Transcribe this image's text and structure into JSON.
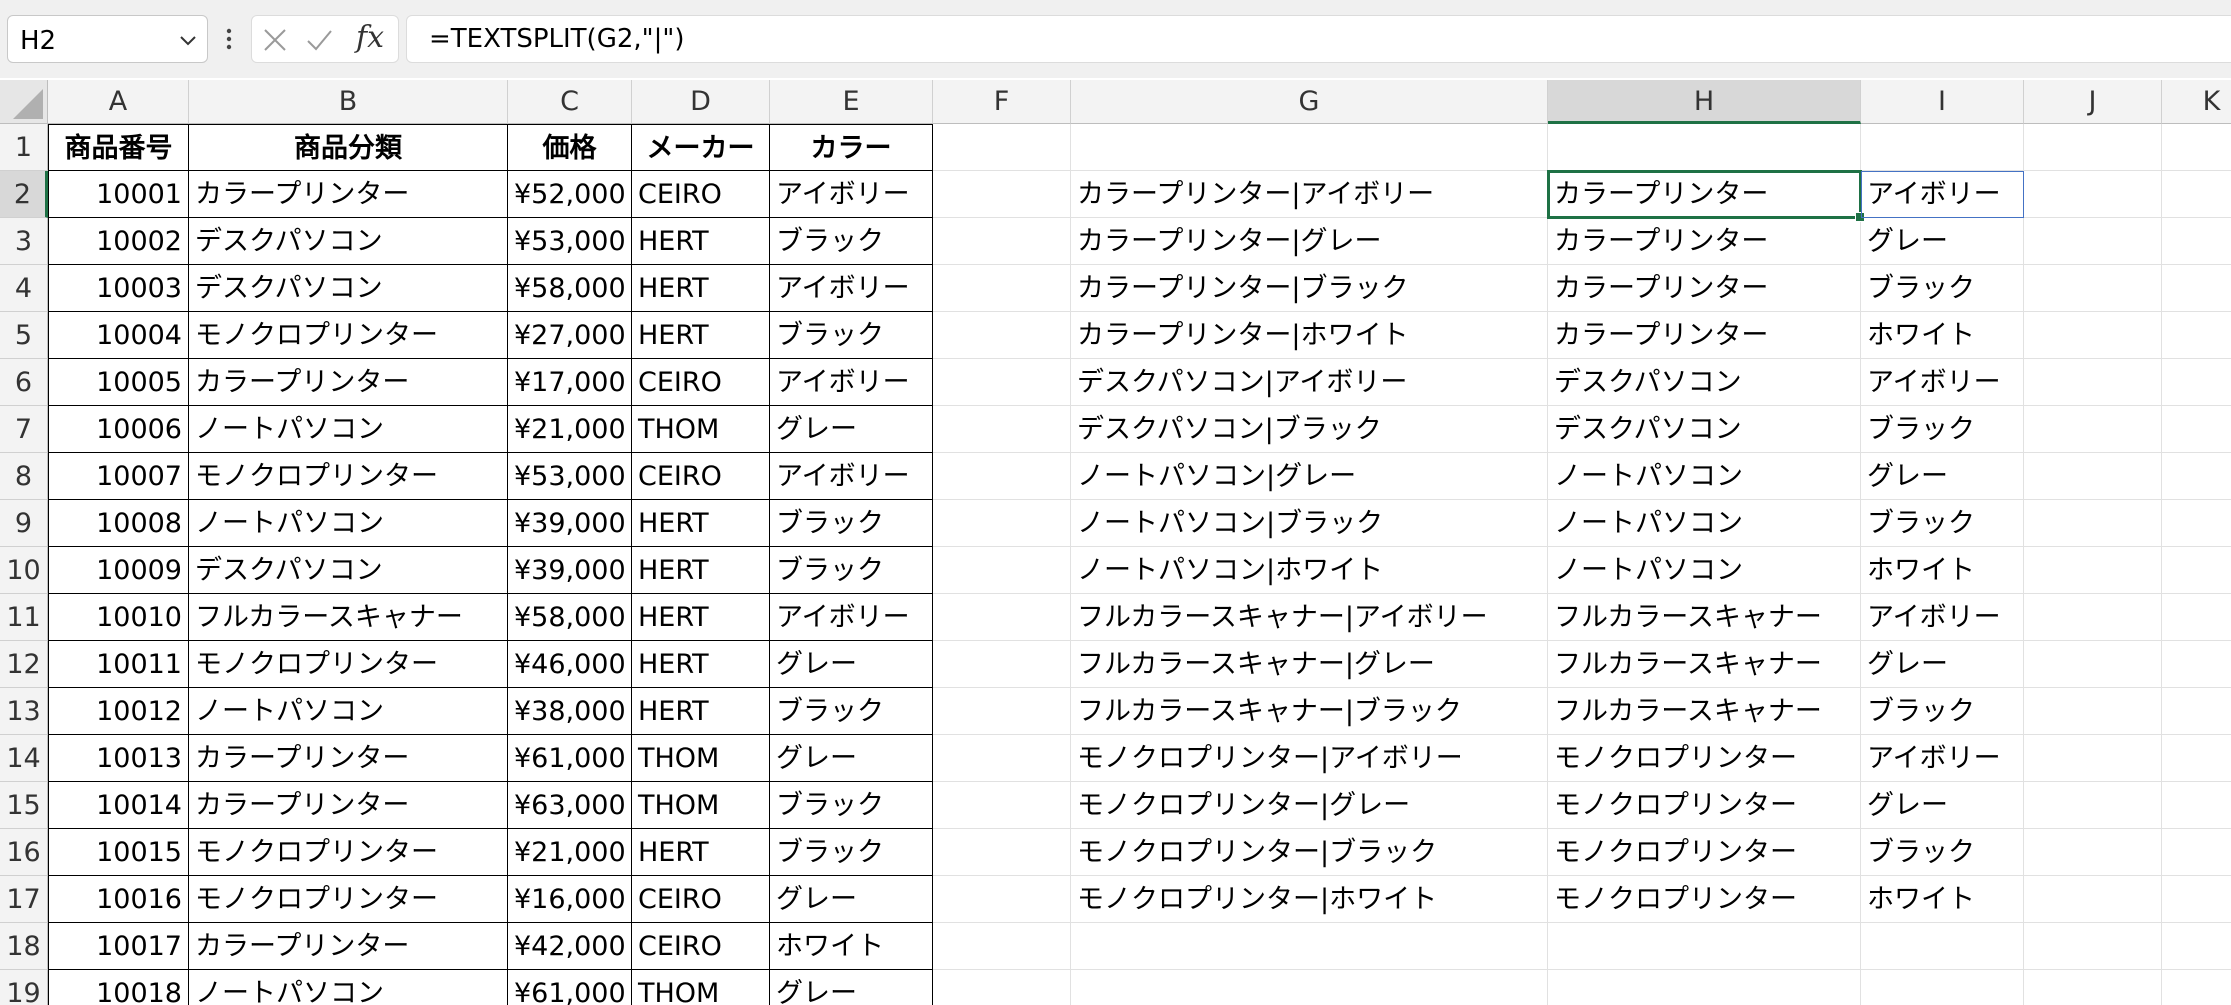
{
  "formula_bar": {
    "name_box": "H2",
    "fx_label": "fx",
    "formula": "=TEXTSPLIT(G2,\"|\")"
  },
  "active_cell": "H2",
  "columns": [
    {
      "letter": "A"
    },
    {
      "letter": "B"
    },
    {
      "letter": "C"
    },
    {
      "letter": "D"
    },
    {
      "letter": "E"
    },
    {
      "letter": "F"
    },
    {
      "letter": "G"
    },
    {
      "letter": "H"
    },
    {
      "letter": "I"
    },
    {
      "letter": "J"
    },
    {
      "letter": "K"
    }
  ],
  "rows": [
    {
      "num": "1",
      "cells": [
        "商品番号",
        "商品分類",
        "価格",
        "メーカー",
        "カラー",
        "",
        "",
        "",
        ""
      ]
    },
    {
      "num": "2",
      "cells": [
        "10001",
        "カラープリンター",
        "¥52,000",
        "CEIRO",
        "アイボリー",
        "",
        "カラープリンター|アイボリー",
        "カラープリンター",
        "アイボリー"
      ]
    },
    {
      "num": "3",
      "cells": [
        "10002",
        "デスクパソコン",
        "¥53,000",
        "HERT",
        "ブラック",
        "",
        "カラープリンター|グレー",
        "カラープリンター",
        "グレー"
      ]
    },
    {
      "num": "4",
      "cells": [
        "10003",
        "デスクパソコン",
        "¥58,000",
        "HERT",
        "アイボリー",
        "",
        "カラープリンター|ブラック",
        "カラープリンター",
        "ブラック"
      ]
    },
    {
      "num": "5",
      "cells": [
        "10004",
        "モノクロプリンター",
        "¥27,000",
        "HERT",
        "ブラック",
        "",
        "カラープリンター|ホワイト",
        "カラープリンター",
        "ホワイト"
      ]
    },
    {
      "num": "6",
      "cells": [
        "10005",
        "カラープリンター",
        "¥17,000",
        "CEIRO",
        "アイボリー",
        "",
        "デスクパソコン|アイボリー",
        "デスクパソコン",
        "アイボリー"
      ]
    },
    {
      "num": "7",
      "cells": [
        "10006",
        "ノートパソコン",
        "¥21,000",
        "THOM",
        "グレー",
        "",
        "デスクパソコン|ブラック",
        "デスクパソコン",
        "ブラック"
      ]
    },
    {
      "num": "8",
      "cells": [
        "10007",
        "モノクロプリンター",
        "¥53,000",
        "CEIRO",
        "アイボリー",
        "",
        "ノートパソコン|グレー",
        "ノートパソコン",
        "グレー"
      ]
    },
    {
      "num": "9",
      "cells": [
        "10008",
        "ノートパソコン",
        "¥39,000",
        "HERT",
        "ブラック",
        "",
        "ノートパソコン|ブラック",
        "ノートパソコン",
        "ブラック"
      ]
    },
    {
      "num": "10",
      "cells": [
        "10009",
        "デスクパソコン",
        "¥39,000",
        "HERT",
        "ブラック",
        "",
        "ノートパソコン|ホワイト",
        "ノートパソコン",
        "ホワイト"
      ]
    },
    {
      "num": "11",
      "cells": [
        "10010",
        "フルカラースキャナー",
        "¥58,000",
        "HERT",
        "アイボリー",
        "",
        "フルカラースキャナー|アイボリー",
        "フルカラースキャナー",
        "アイボリー"
      ]
    },
    {
      "num": "12",
      "cells": [
        "10011",
        "モノクロプリンター",
        "¥46,000",
        "HERT",
        "グレー",
        "",
        "フルカラースキャナー|グレー",
        "フルカラースキャナー",
        "グレー"
      ]
    },
    {
      "num": "13",
      "cells": [
        "10012",
        "ノートパソコン",
        "¥38,000",
        "HERT",
        "ブラック",
        "",
        "フルカラースキャナー|ブラック",
        "フルカラースキャナー",
        "ブラック"
      ]
    },
    {
      "num": "14",
      "cells": [
        "10013",
        "カラープリンター",
        "¥61,000",
        "THOM",
        "グレー",
        "",
        "モノクロプリンター|アイボリー",
        "モノクロプリンター",
        "アイボリー"
      ]
    },
    {
      "num": "15",
      "cells": [
        "10014",
        "カラープリンター",
        "¥63,000",
        "THOM",
        "ブラック",
        "",
        "モノクロプリンター|グレー",
        "モノクロプリンター",
        "グレー"
      ]
    },
    {
      "num": "16",
      "cells": [
        "10015",
        "モノクロプリンター",
        "¥21,000",
        "HERT",
        "ブラック",
        "",
        "モノクロプリンター|ブラック",
        "モノクロプリンター",
        "ブラック"
      ]
    },
    {
      "num": "17",
      "cells": [
        "10016",
        "モノクロプリンター",
        "¥16,000",
        "CEIRO",
        "グレー",
        "",
        "モノクロプリンター|ホワイト",
        "モノクロプリンター",
        "ホワイト"
      ]
    },
    {
      "num": "18",
      "cells": [
        "10017",
        "カラープリンター",
        "¥42,000",
        "CEIRO",
        "ホワイト",
        "",
        "",
        "",
        ""
      ]
    },
    {
      "num": "19",
      "cells": [
        "10018",
        "ノートパソコン",
        "¥61,000",
        "THOM",
        "グレー",
        "",
        "",
        "",
        ""
      ]
    }
  ]
}
